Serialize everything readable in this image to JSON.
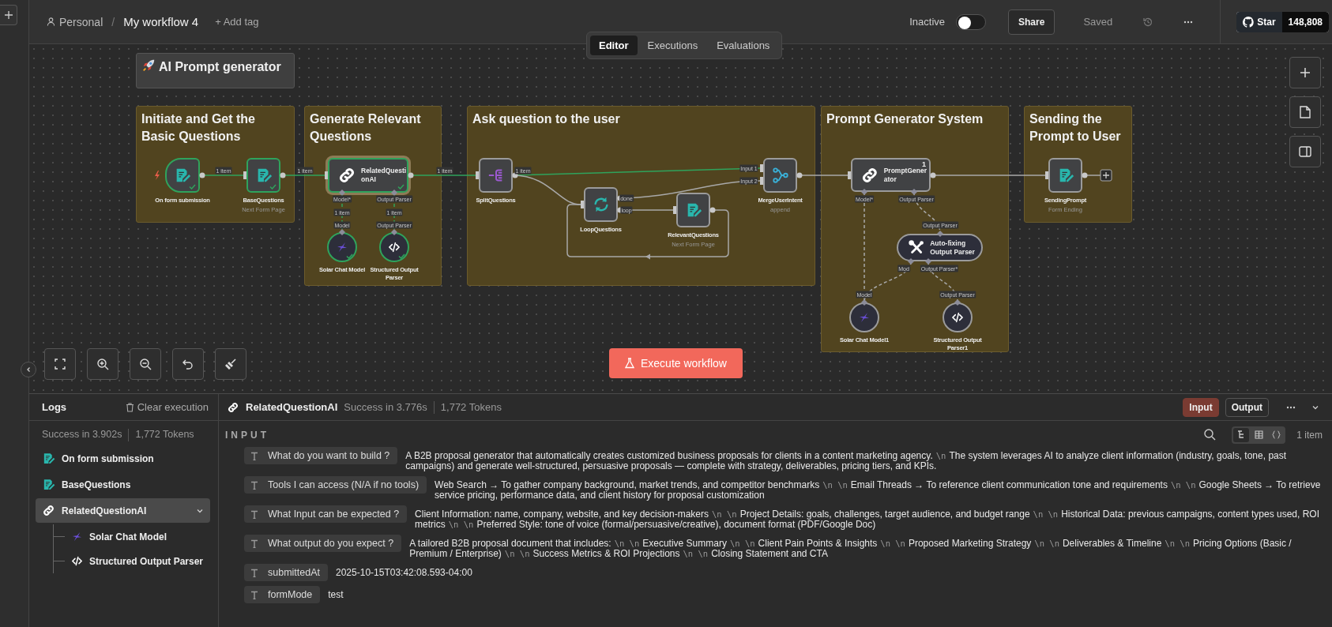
{
  "header": {
    "project": "Personal",
    "separator": "/",
    "workflow": "My workflow 4",
    "add_tag": "+ Add tag",
    "activation": {
      "label": "Inactive",
      "on": false
    },
    "share": "Share",
    "save_state": "Saved",
    "github": {
      "label": "Star",
      "count": "148,808"
    }
  },
  "tabs": [
    {
      "label": "Editor",
      "selected": true
    },
    {
      "label": "Executions",
      "selected": false
    },
    {
      "label": "Evaluations",
      "selected": false
    }
  ],
  "canvas": {
    "title_note": "AI Prompt generator",
    "notes": [
      {
        "title": "Initiate and Get the Basic Questions"
      },
      {
        "title": "Generate Relevant Questions"
      },
      {
        "title": "Ask question to the user"
      },
      {
        "title": "Prompt Generator System"
      },
      {
        "title": "Sending the Prompt to User"
      }
    ],
    "nodes": [
      {
        "kind": "form_trigger",
        "name": "On form submission",
        "executed": true,
        "selected": false
      },
      {
        "kind": "form",
        "name": "BaseQuestions",
        "subtitle": "Next Form Page",
        "executed": true,
        "selected": false
      },
      {
        "kind": "agent",
        "name": "RelatedQuestionAI",
        "executed": true,
        "selected": true
      },
      {
        "kind": "chat_model",
        "name": "Solar Chat Model",
        "executed": true,
        "selected": false
      },
      {
        "kind": "output_parser",
        "name": "Structured Output Parser",
        "executed": true,
        "selected": false
      },
      {
        "kind": "split",
        "name": "SplitQuestions",
        "executed": false,
        "selected": false
      },
      {
        "kind": "loop",
        "name": "LoopQuestions",
        "executed": false,
        "selected": false
      },
      {
        "kind": "form",
        "name": "RelevantQuestions",
        "subtitle": "Next Form Page",
        "executed": false,
        "selected": false
      },
      {
        "kind": "merge",
        "name": "MergeUserIntent",
        "subtitle": "append",
        "executed": false,
        "selected": false
      },
      {
        "kind": "agent",
        "name": "PromptGenerator",
        "badge": "1",
        "executed": false,
        "selected": false
      },
      {
        "kind": "autofix_parser",
        "name": "Auto-fixing Output Parser",
        "executed": false,
        "selected": false
      },
      {
        "kind": "chat_model",
        "name": "Solar Chat Model1",
        "executed": false,
        "selected": false
      },
      {
        "kind": "output_parser",
        "name": "Structured Output Parser1",
        "executed": false,
        "selected": false
      },
      {
        "kind": "form",
        "name": "SendingPrompt",
        "subtitle": "Form Ending",
        "executed": false,
        "selected": false
      }
    ],
    "edge_labels": [
      {
        "text": "1 item"
      },
      {
        "text": "1 item"
      },
      {
        "text": "1 item"
      },
      {
        "text": "1 item"
      },
      {
        "text": "Input 1"
      },
      {
        "text": "Input 2"
      },
      {
        "text": "done"
      },
      {
        "text": "loop"
      },
      {
        "text": "Model*"
      },
      {
        "text": "Output Parser"
      },
      {
        "text": "1 item"
      },
      {
        "text": "1 item"
      },
      {
        "text": "Model"
      },
      {
        "text": "Output Parser"
      },
      {
        "text": "Model*"
      },
      {
        "text": "Output Parser"
      },
      {
        "text": "Output Parser"
      },
      {
        "text": "Mod"
      },
      {
        "text": "Output Parser*"
      },
      {
        "text": "Model"
      },
      {
        "text": "Output Parser"
      }
    ],
    "execute_button": "Execute workflow"
  },
  "logs": {
    "title": "Logs",
    "clear": "Clear execution",
    "summary": {
      "time": "Success in 3.902s",
      "tokens": "1,772 Tokens"
    },
    "tree": [
      {
        "kind": "form",
        "name": "On form submission",
        "selected": false
      },
      {
        "kind": "form",
        "name": "BaseQuestions",
        "selected": false
      },
      {
        "kind": "agent",
        "name": "RelatedQuestionAI",
        "selected": true,
        "expanded": true,
        "children": [
          {
            "kind": "chat_model",
            "name": "Solar Chat Model",
            "selected": false
          },
          {
            "kind": "output_parser",
            "name": "Structured Output Parser",
            "selected": false
          }
        ]
      }
    ],
    "detail": {
      "kind": "agent",
      "name": "RelatedQuestionAI",
      "status": "Success in 3.776s",
      "tokens": "1,772 Tokens",
      "modes": [
        {
          "label": "Input",
          "selected": true
        },
        {
          "label": "Output",
          "selected": false
        }
      ],
      "section": "INPUT",
      "views": [
        {
          "kind": "schema",
          "selected": true
        },
        {
          "kind": "table",
          "selected": false
        },
        {
          "kind": "json",
          "selected": false
        }
      ],
      "count": "1 item",
      "fields": [
        {
          "key": "What do you want to build ?",
          "value": [
            {
              "kind": "text",
              "text": "A B2B proposal generator that automatically creates customized business proposals for clients in a content marketing agency."
            },
            {
              "kind": "escape",
              "text": "\\n"
            },
            {
              "kind": "text",
              "text": "The system leverages AI to analyze client information (industry, goals, tone, past campaigns) and generate well-structured, persuasive proposals — complete with strategy, deliverables, pricing tiers, and KPIs."
            }
          ]
        },
        {
          "key": "Tools I can access (N/A if no tools)",
          "value": [
            {
              "kind": "text",
              "text": "Web Search → To gather company background, market trends, and competitor benchmarks"
            },
            {
              "kind": "escape",
              "text": "\\n \\n"
            },
            {
              "kind": "text",
              "text": "Email Threads → To reference client communication tone and requirements"
            },
            {
              "kind": "escape",
              "text": "\\n \\n"
            },
            {
              "kind": "text",
              "text": "Google Sheets → To retrieve service pricing, performance data, and client history for proposal customization"
            }
          ]
        },
        {
          "key": "What Input can be expected ?",
          "value": [
            {
              "kind": "text",
              "text": "Client Information: name, company, website, and key decision-makers"
            },
            {
              "kind": "escape",
              "text": "\\n \\n"
            },
            {
              "kind": "text",
              "text": "Project Details: goals, challenges, target audience, and budget range"
            },
            {
              "kind": "escape",
              "text": "\\n \\n"
            },
            {
              "kind": "text",
              "text": "Historical Data: previous campaigns, content types used, ROI metrics"
            },
            {
              "kind": "escape",
              "text": "\\n \\n"
            },
            {
              "kind": "text",
              "text": "Preferred Style: tone of voice (formal/persuasive/creative), document format (PDF/Google Doc)"
            }
          ]
        },
        {
          "key": "What output do you expect ?",
          "value": [
            {
              "kind": "text",
              "text": "A tailored B2B proposal document that includes:"
            },
            {
              "kind": "escape",
              "text": "\\n \\n"
            },
            {
              "kind": "text",
              "text": "Executive Summary"
            },
            {
              "kind": "escape",
              "text": "\\n \\n"
            },
            {
              "kind": "text",
              "text": "Client Pain Points & Insights"
            },
            {
              "kind": "escape",
              "text": "\\n \\n"
            },
            {
              "kind": "text",
              "text": "Proposed Marketing Strategy"
            },
            {
              "kind": "escape",
              "text": "\\n \\n"
            },
            {
              "kind": "text",
              "text": "Deliverables & Timeline"
            },
            {
              "kind": "escape",
              "text": "\\n \\n"
            },
            {
              "kind": "text",
              "text": "Pricing Options (Basic / Premium / Enterprise)"
            },
            {
              "kind": "escape",
              "text": "\\n \\n"
            },
            {
              "kind": "text",
              "text": "Success Metrics & ROI Projections"
            },
            {
              "kind": "escape",
              "text": "\\n \\n"
            },
            {
              "kind": "text",
              "text": "Closing Statement and CTA"
            }
          ]
        },
        {
          "key": "submittedAt",
          "value": [
            {
              "kind": "text",
              "text": "2025-10-15T03:42:08.593-04:00"
            }
          ]
        },
        {
          "key": "formMode",
          "value": [
            {
              "kind": "text",
              "text": "test"
            }
          ]
        }
      ]
    }
  }
}
